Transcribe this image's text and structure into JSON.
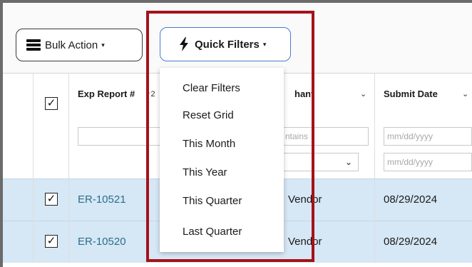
{
  "toolbar": {
    "bulk_action_label": "Bulk Action",
    "quick_filters_label": "Quick Filters",
    "caret": "▾"
  },
  "quick_filters_menu": {
    "items": [
      "Clear Filters",
      "Reset Grid",
      "This Month",
      "This Year",
      "This Quarter",
      "Last Quarter"
    ]
  },
  "grid": {
    "header_checkbox": "✓",
    "columns": {
      "exp_report": "Exp Report #",
      "merchant": "hant",
      "submit_date": "Submit Date"
    },
    "sort_indicator": "↑2",
    "filters": {
      "merchant_placeholder": "ntains",
      "date_from_placeholder": "mm/dd/yyyy",
      "date_to_placeholder": "mm/dd/yyyy"
    },
    "rows": [
      {
        "checked": "✓",
        "exp_report": "ER-10521",
        "merchant": "Vendor",
        "submit_date": "08/29/2024"
      },
      {
        "checked": "✓",
        "exp_report": "ER-10520",
        "merchant": "Vendor",
        "submit_date": "08/29/2024"
      }
    ]
  },
  "colors": {
    "highlight": "#a5121b",
    "row_selected": "#d6e7f5",
    "link": "#2a6f8a",
    "quick_filter_border": "#4a7bd0"
  },
  "icons": {
    "bulk_action": "stack-icon",
    "quick_filters": "lightning-bolt-icon"
  }
}
